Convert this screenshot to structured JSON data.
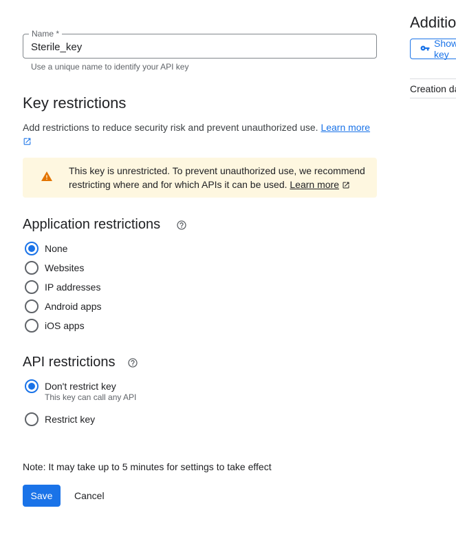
{
  "name_field": {
    "legend": "Name *",
    "value": "Sterile_key",
    "hint": "Use a unique name to identify your API key"
  },
  "key_restrictions": {
    "title": "Key restrictions",
    "description": "Add restrictions to reduce security risk and prevent unauthorized use.",
    "learn_more": "Learn more"
  },
  "warning": {
    "text": "This key is unrestricted. To prevent unauthorized use, we recommend restricting where and for which APIs it can be used.",
    "learn_more": "Learn more"
  },
  "application_restrictions": {
    "title": "Application restrictions",
    "options": [
      {
        "label": "None",
        "checked": true
      },
      {
        "label": "Websites",
        "checked": false
      },
      {
        "label": "IP addresses",
        "checked": false
      },
      {
        "label": "Android apps",
        "checked": false
      },
      {
        "label": "iOS apps",
        "checked": false
      }
    ]
  },
  "api_restrictions": {
    "title": "API restrictions",
    "options": [
      {
        "label": "Don't restrict key",
        "sublabel": "This key can call any API",
        "checked": true
      },
      {
        "label": "Restrict key",
        "checked": false
      }
    ]
  },
  "note": "Note: It may take up to 5 minutes for settings to take effect",
  "buttons": {
    "save": "Save",
    "cancel": "Cancel"
  },
  "right_panel": {
    "title": "Additional information",
    "show_button": "Show key",
    "creation_label": "Creation date"
  },
  "colors": {
    "primary": "#1a73e8",
    "warning_bg": "#fef7e0",
    "warning_icon": "#e37400"
  }
}
